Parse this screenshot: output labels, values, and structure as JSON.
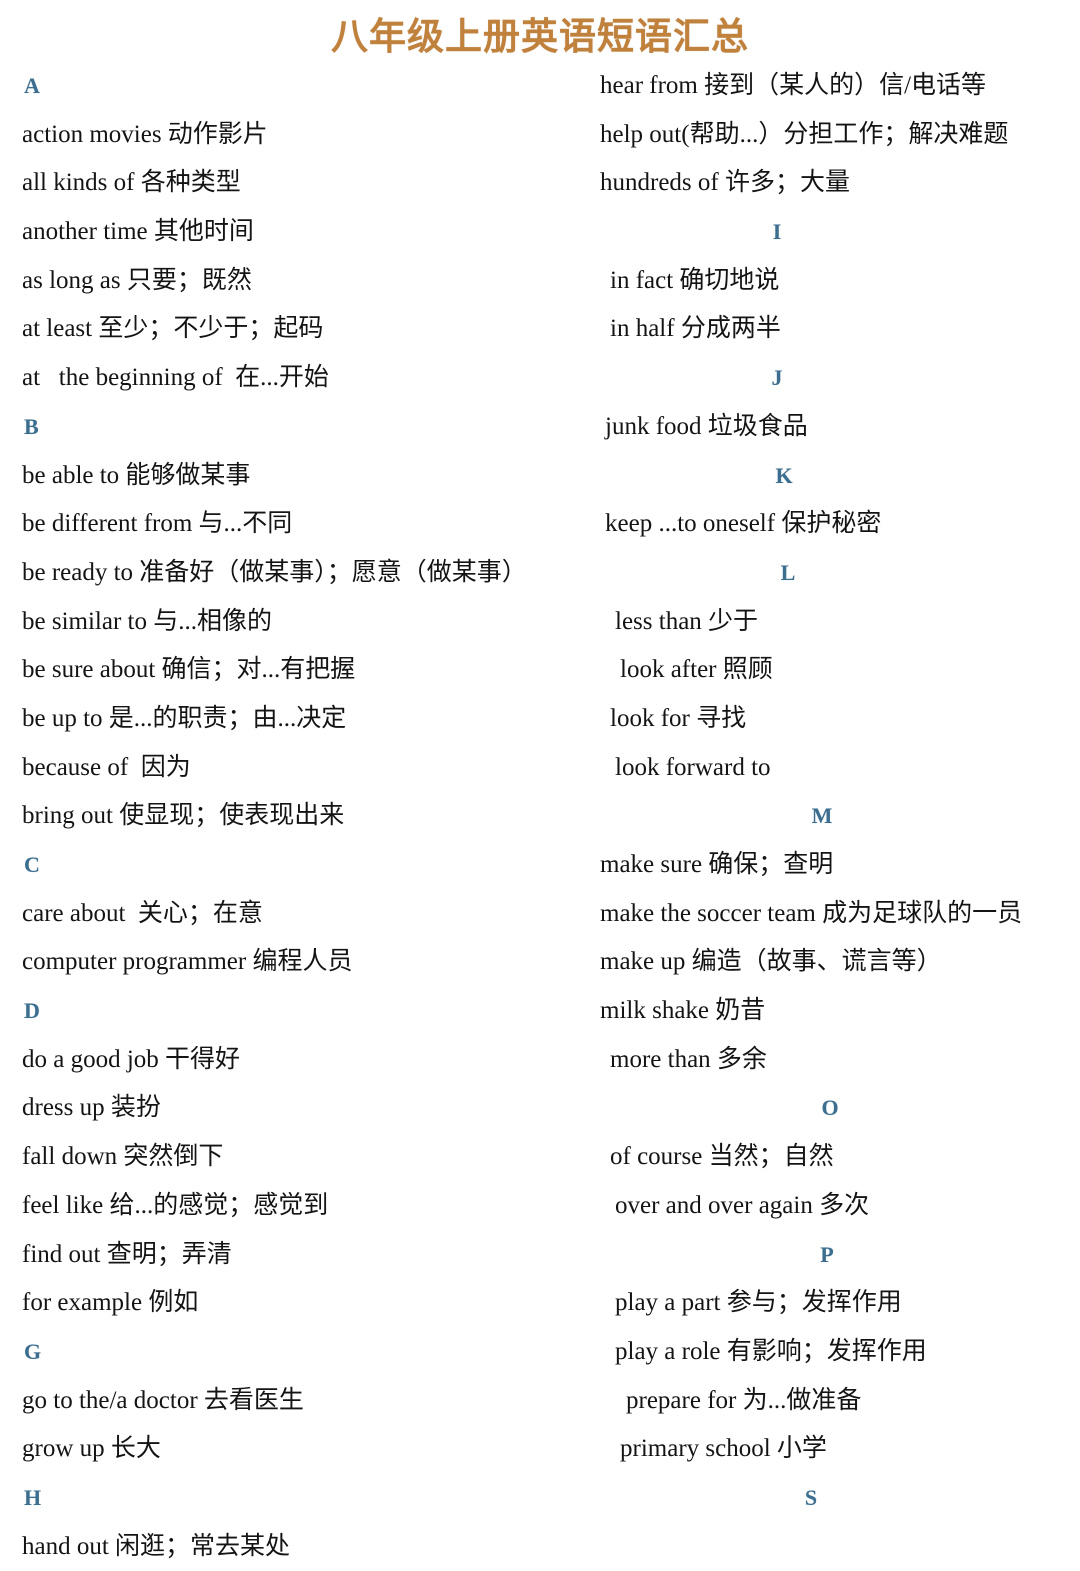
{
  "document": {
    "title": "八年级上册英语短语汇总",
    "title_color": "#c0813c",
    "section_letter_color": "#3c6e8f",
    "body_text_color": "#141414",
    "background_color": "#ffffff"
  },
  "left_column": {
    "rows": [
      {
        "kind": "section",
        "text": "A"
      },
      {
        "kind": "entry",
        "text": "action movies 动作影片"
      },
      {
        "kind": "entry",
        "text": "all kinds of 各种类型"
      },
      {
        "kind": "entry",
        "text": "another time 其他时间"
      },
      {
        "kind": "entry",
        "text": "as long as 只要；既然"
      },
      {
        "kind": "entry",
        "text": "at least 至少；不少于；起码"
      },
      {
        "kind": "entry",
        "text": "at   the beginning of  在...开始"
      },
      {
        "kind": "section",
        "text": "B"
      },
      {
        "kind": "entry",
        "text": "be able to 能够做某事"
      },
      {
        "kind": "entry",
        "text": "be different from 与...不同"
      },
      {
        "kind": "entry",
        "text": "be ready to 准备好（做某事）；愿意（做某事）"
      },
      {
        "kind": "entry",
        "text": "be similar to 与...相像的"
      },
      {
        "kind": "entry",
        "text": "be sure about 确信；对...有把握"
      },
      {
        "kind": "entry",
        "text": "be up to 是...的职责；由...决定"
      },
      {
        "kind": "entry",
        "text": "because of  因为"
      },
      {
        "kind": "entry",
        "text": "bring out 使显现；使表现出来"
      },
      {
        "kind": "section",
        "text": "C"
      },
      {
        "kind": "entry",
        "text": "care about  关心；在意"
      },
      {
        "kind": "entry",
        "text": "computer programmer 编程人员"
      },
      {
        "kind": "section",
        "text": "D"
      },
      {
        "kind": "entry",
        "text": "do a good job 干得好"
      },
      {
        "kind": "entry",
        "text": "dress up 装扮"
      },
      {
        "kind": "entry",
        "text": "fall down 突然倒下"
      },
      {
        "kind": "entry",
        "text": "feel like 给...的感觉；感觉到"
      },
      {
        "kind": "entry",
        "text": "find out 查明；弄清"
      },
      {
        "kind": "entry",
        "text": "for example 例如"
      },
      {
        "kind": "section",
        "text": "G"
      },
      {
        "kind": "entry",
        "text": "go to the/a doctor 去看医生"
      },
      {
        "kind": "entry",
        "text": "grow up 长大"
      },
      {
        "kind": "section",
        "text": "H"
      },
      {
        "kind": "entry",
        "text": "hand out 闲逛；常去某处"
      }
    ]
  },
  "right_column": {
    "rows": [
      {
        "kind": "entry",
        "text": "hear from 接到（某人的）信/电话等",
        "indent": 2
      },
      {
        "kind": "entry",
        "text": "help out(帮助...）分担工作；解决难题",
        "indent": 2
      },
      {
        "kind": "entry",
        "text": "hundreds of 许多；大量",
        "indent": 2
      },
      {
        "kind": "section",
        "text": "I",
        "offset": "i"
      },
      {
        "kind": "entry",
        "text": "in fact 确切地说",
        "indent": 4
      },
      {
        "kind": "entry",
        "text": "in half 分成两半",
        "indent": 4
      },
      {
        "kind": "section",
        "text": "J",
        "offset": "j"
      },
      {
        "kind": "entry",
        "text": "junk food 垃圾食品",
        "indent": 3
      },
      {
        "kind": "section",
        "text": "K",
        "offset": "k"
      },
      {
        "kind": "entry",
        "text": "keep ...to oneself 保护秘密",
        "indent": 3
      },
      {
        "kind": "section",
        "text": "L",
        "offset": "l"
      },
      {
        "kind": "entry",
        "text": "less than 少于",
        "indent": 5
      },
      {
        "kind": "entry",
        "text": "look after 照顾",
        "indent": 6
      },
      {
        "kind": "entry",
        "text": "look for 寻找",
        "indent": 4
      },
      {
        "kind": "entry",
        "text": "look forward to",
        "indent": 5
      },
      {
        "kind": "section",
        "text": "M",
        "offset": "m"
      },
      {
        "kind": "entry",
        "text": "make sure 确保；查明",
        "indent": 2
      },
      {
        "kind": "entry",
        "text": "make the soccer team 成为足球队的一员",
        "indent": 2
      },
      {
        "kind": "entry",
        "text": "make up 编造（故事、谎言等）",
        "indent": 2
      },
      {
        "kind": "entry",
        "text": "milk shake 奶昔",
        "indent": 2
      },
      {
        "kind": "entry",
        "text": "more than 多余",
        "indent": 4
      },
      {
        "kind": "section",
        "text": "O",
        "offset": "o"
      },
      {
        "kind": "entry",
        "text": "of course 当然；自然",
        "indent": 4
      },
      {
        "kind": "entry",
        "text": "over and over again 多次",
        "indent": 5
      },
      {
        "kind": "section",
        "text": "P",
        "offset": "p"
      },
      {
        "kind": "entry",
        "text": "play a part 参与；发挥作用",
        "indent": 5
      },
      {
        "kind": "entry",
        "text": "play a role 有影响；发挥作用",
        "indent": 5
      },
      {
        "kind": "entry",
        "text": "prepare for 为...做准备",
        "indent": 7
      },
      {
        "kind": "entry",
        "text": "primary school 小学",
        "indent": 6
      },
      {
        "kind": "section",
        "text": "S",
        "offset": "s"
      }
    ]
  }
}
